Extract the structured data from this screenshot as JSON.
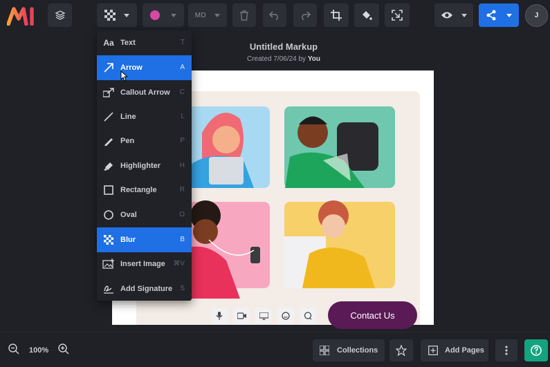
{
  "app": {
    "logo": "markup-logo",
    "accent_color": "#1f6fe5",
    "logo_colors": [
      "#f7a33a",
      "#e8415d"
    ]
  },
  "toolbar": {
    "layers_icon": "layers-icon",
    "blur_tool_icon": "blur-checker-icon",
    "color_swatch": "#d946a8",
    "size_label": "MD",
    "delete_icon": "trash-icon",
    "undo_icon": "undo-icon",
    "redo_icon": "redo-icon",
    "crop_icon": "crop-icon",
    "fill_icon": "paint-bucket-icon",
    "capture_icon": "capture-icon",
    "view_icon": "eye-icon",
    "share_icon": "share-icon",
    "avatar_initial": "J"
  },
  "document": {
    "title": "Untitled Markup",
    "created_prefix": "Created 7/06/24 by ",
    "created_by": "You"
  },
  "tool_menu": {
    "items": [
      {
        "label": "Text",
        "shortcut": "T",
        "icon": "text-icon",
        "icon_glyph": "Aa",
        "active": false
      },
      {
        "label": "Arrow",
        "shortcut": "A",
        "icon": "arrow-icon",
        "active": true
      },
      {
        "label": "Callout Arrow",
        "shortcut": "C",
        "icon": "callout-arrow-icon",
        "active": false
      },
      {
        "label": "Line",
        "shortcut": "L",
        "icon": "line-icon",
        "active": false
      },
      {
        "label": "Pen",
        "shortcut": "P",
        "icon": "pen-icon",
        "active": false
      },
      {
        "label": "Highlighter",
        "shortcut": "H",
        "icon": "highlighter-icon",
        "active": false
      },
      {
        "label": "Rectangle",
        "shortcut": "R",
        "icon": "rectangle-icon",
        "active": false
      },
      {
        "label": "Oval",
        "shortcut": "O",
        "icon": "oval-icon",
        "active": false
      },
      {
        "label": "Blur",
        "shortcut": "B",
        "icon": "blur-icon",
        "active": true
      },
      {
        "label": "Insert Image",
        "shortcut": "⌘V",
        "icon": "insert-image-icon",
        "active": false
      },
      {
        "label": "Add Signature",
        "shortcut": "S",
        "icon": "signature-icon",
        "active": false
      }
    ]
  },
  "canvas_image": {
    "contact_button": "Contact Us",
    "mini_icons": [
      "microphone-icon",
      "video-icon",
      "screen-icon",
      "emoji-icon",
      "chat-icon"
    ]
  },
  "bottom": {
    "zoom_out_icon": "zoom-out-icon",
    "zoom_level": "100%",
    "zoom_in_icon": "zoom-in-icon",
    "collections_label": "Collections",
    "favorite_icon": "star-icon",
    "add_pages_label": "Add Pages",
    "more_icon": "more-vertical-icon",
    "help_icon": "help-icon",
    "help_color": "#14a37f"
  }
}
